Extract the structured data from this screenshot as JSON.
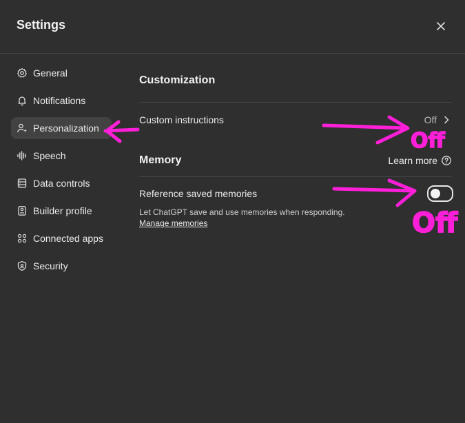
{
  "header": {
    "title": "Settings",
    "close_icon": "close-icon"
  },
  "sidebar": {
    "items": [
      {
        "label": "General",
        "icon": "gear-icon",
        "active": false
      },
      {
        "label": "Notifications",
        "icon": "bell-icon",
        "active": false
      },
      {
        "label": "Personalization",
        "icon": "user-sparkle-icon",
        "active": true
      },
      {
        "label": "Speech",
        "icon": "waveform-icon",
        "active": false
      },
      {
        "label": "Data controls",
        "icon": "database-icon",
        "active": false
      },
      {
        "label": "Builder profile",
        "icon": "id-card-icon",
        "active": false
      },
      {
        "label": "Connected apps",
        "icon": "apps-grid-icon",
        "active": false
      },
      {
        "label": "Security",
        "icon": "shield-icon",
        "active": false
      }
    ]
  },
  "customization": {
    "title": "Customization",
    "custom_instructions": {
      "label": "Custom instructions",
      "value": "Off"
    }
  },
  "memory": {
    "title": "Memory",
    "learn_more": "Learn more",
    "reference_saved": {
      "label": "Reference saved memories",
      "toggle_on": false,
      "description": "Let ChatGPT save and use memories when responding.",
      "manage_link": "Manage memories"
    }
  },
  "annotations": {
    "color": "#ff1fd8",
    "labels": [
      "Off",
      "Off"
    ]
  }
}
